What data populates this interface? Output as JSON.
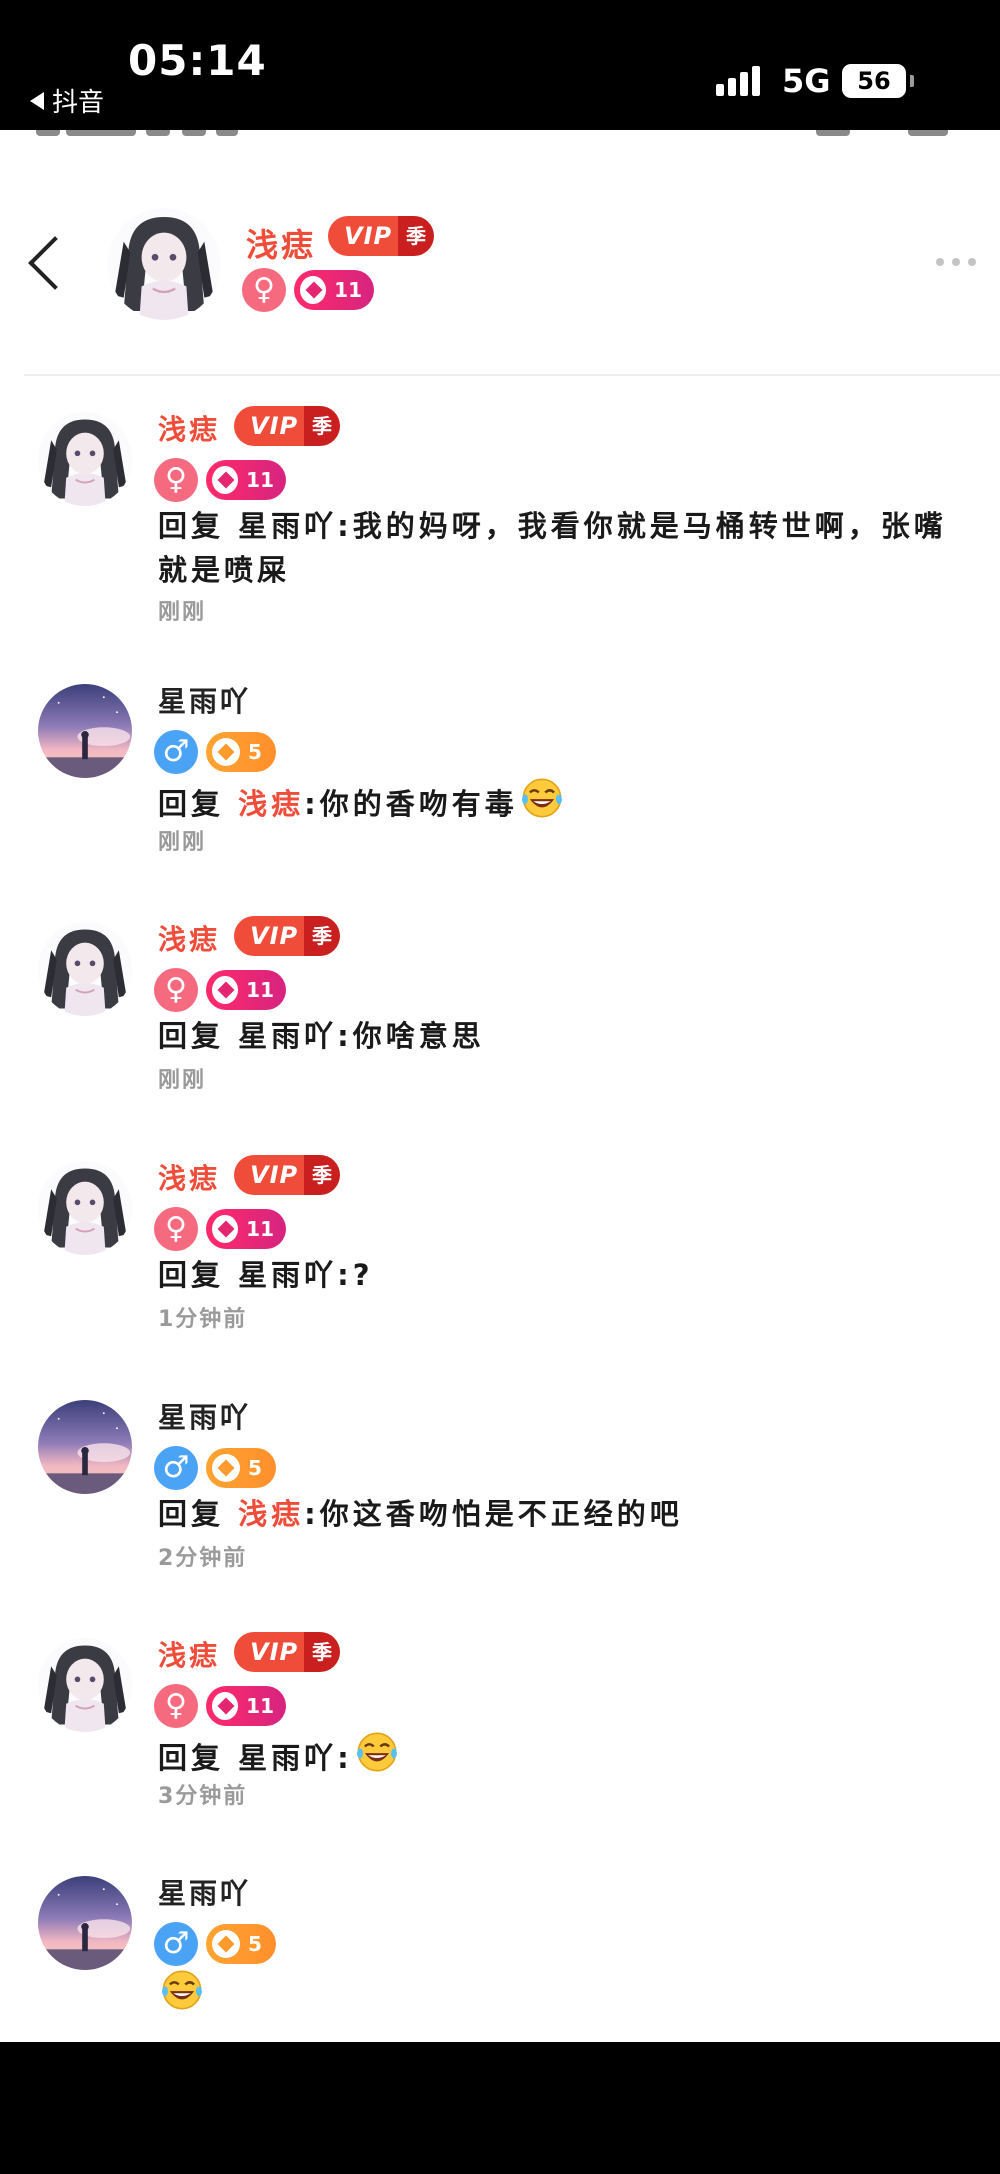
{
  "status_bar": {
    "time": "05:14",
    "back_app": "抖音",
    "network": "5G",
    "battery": "56"
  },
  "header": {
    "username": "浅痣",
    "vip_text": "VIP",
    "vip_season": "季",
    "level": "11"
  },
  "comments": [
    {
      "author": "浅痣",
      "vip_text": "VIP",
      "vip_season": "季",
      "gender": "female",
      "level": "11",
      "reply_prefix": "回复 ",
      "reply_to": "星雨吖",
      "reply_colon": ":",
      "text": "我的妈呀，我看你就是马桶转世啊，张嘴就是喷屎",
      "time": "刚刚"
    },
    {
      "author": "星雨吖",
      "gender": "male",
      "level": "5",
      "reply_prefix": "回复 ",
      "reply_to": "浅痣",
      "reply_colon": ":",
      "text": "你的香吻有毒",
      "emoji": "tears-of-joy",
      "time": "刚刚"
    },
    {
      "author": "浅痣",
      "vip_text": "VIP",
      "vip_season": "季",
      "gender": "female",
      "level": "11",
      "reply_prefix": "回复 ",
      "reply_to": "星雨吖",
      "reply_colon": ":",
      "text": "你啥意思",
      "time": "刚刚"
    },
    {
      "author": "浅痣",
      "vip_text": "VIP",
      "vip_season": "季",
      "gender": "female",
      "level": "11",
      "reply_prefix": "回复 ",
      "reply_to": "星雨吖",
      "reply_colon": ":",
      "text": "?",
      "time": "1分钟前"
    },
    {
      "author": "星雨吖",
      "gender": "male",
      "level": "5",
      "reply_prefix": "回复 ",
      "reply_to": "浅痣",
      "reply_colon": ":",
      "text": "你这香吻怕是不正经的吧",
      "time": "2分钟前"
    },
    {
      "author": "浅痣",
      "vip_text": "VIP",
      "vip_season": "季",
      "gender": "female",
      "level": "11",
      "reply_prefix": "回复 ",
      "reply_to": "星雨吖",
      "reply_colon": ":",
      "text": "",
      "emoji": "tears-of-joy",
      "time": "3分钟前"
    },
    {
      "author": "星雨吖",
      "gender": "male",
      "level": "5",
      "text": "",
      "emoji": "tears-of-joy"
    }
  ],
  "icons": {
    "female": "♀",
    "male": "♂",
    "back": "chevron-left-icon",
    "more": "more-dots-icon"
  },
  "colors": {
    "accent_red": "#f04c3a",
    "vip_dark": "#c91f1f",
    "female_pink": "#f56a7f",
    "male_blue": "#4aa3f4",
    "level_pink": "#ff2a6a",
    "level_orange": "#ffa431",
    "time_gray": "#9a9a9a"
  }
}
